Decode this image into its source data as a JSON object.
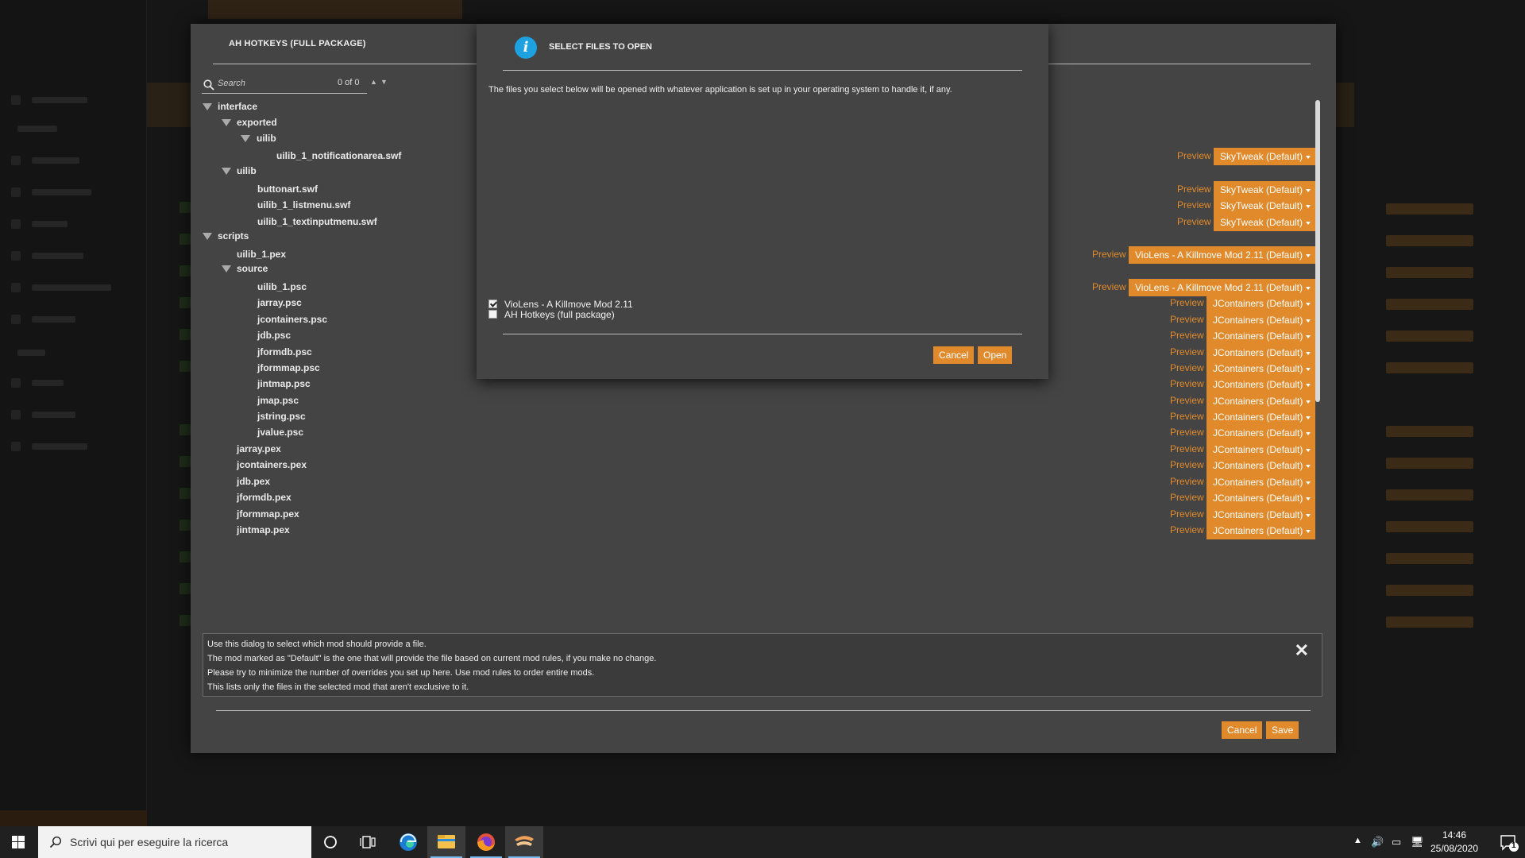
{
  "background_app": {
    "footer_text": "",
    "window_controls": [
      "minimize",
      "maximize",
      "close"
    ]
  },
  "overrides_dialog": {
    "title": "AH HOTKEYS (FULL PACKAGE)",
    "search": {
      "placeholder": "Search",
      "value": "",
      "count": "0 of 0",
      "up": "▲",
      "down": "▼"
    },
    "tree": [
      {
        "name": "interface",
        "depth": 0,
        "expandable": true
      },
      {
        "name": "exported",
        "depth": 1,
        "expandable": true
      },
      {
        "name": "uilib",
        "depth": 2,
        "expandable": true
      },
      {
        "name": "uilib_1_notificationarea.swf",
        "depth": 3,
        "expandable": false,
        "preview": "Preview",
        "provider": "SkyTweak (Default)"
      },
      {
        "name": "uilib",
        "depth": 1,
        "expandable": true
      },
      {
        "name": "buttonart.swf",
        "depth": 2,
        "expandable": false,
        "preview": "Preview",
        "provider": "SkyTweak (Default)"
      },
      {
        "name": "uilib_1_listmenu.swf",
        "depth": 2,
        "expandable": false,
        "preview": "Preview",
        "provider": "SkyTweak (Default)"
      },
      {
        "name": "uilib_1_textinputmenu.swf",
        "depth": 2,
        "expandable": false,
        "preview": "Preview",
        "provider": "SkyTweak (Default)"
      },
      {
        "name": "scripts",
        "depth": 0,
        "expandable": true
      },
      {
        "name": "uilib_1.pex",
        "depth": 1,
        "expandable": false,
        "preview": "Preview",
        "provider": "VioLens - A Killmove Mod 2.11 (Default)"
      },
      {
        "name": "source",
        "depth": 1,
        "expandable": true
      },
      {
        "name": "uilib_1.psc",
        "depth": 2,
        "expandable": false,
        "preview": "Preview",
        "provider": "VioLens - A Killmove Mod 2.11 (Default)"
      },
      {
        "name": "jarray.psc",
        "depth": 2,
        "expandable": false,
        "preview": "Preview",
        "provider": "JContainers (Default)"
      },
      {
        "name": "jcontainers.psc",
        "depth": 2,
        "expandable": false,
        "preview": "Preview",
        "provider": "JContainers (Default)"
      },
      {
        "name": "jdb.psc",
        "depth": 2,
        "expandable": false,
        "preview": "Preview",
        "provider": "JContainers (Default)"
      },
      {
        "name": "jformdb.psc",
        "depth": 2,
        "expandable": false,
        "preview": "Preview",
        "provider": "JContainers (Default)"
      },
      {
        "name": "jformmap.psc",
        "depth": 2,
        "expandable": false,
        "preview": "Preview",
        "provider": "JContainers (Default)"
      },
      {
        "name": "jintmap.psc",
        "depth": 2,
        "expandable": false,
        "preview": "Preview",
        "provider": "JContainers (Default)"
      },
      {
        "name": "jmap.psc",
        "depth": 2,
        "expandable": false,
        "preview": "Preview",
        "provider": "JContainers (Default)"
      },
      {
        "name": "jstring.psc",
        "depth": 2,
        "expandable": false,
        "preview": "Preview",
        "provider": "JContainers (Default)"
      },
      {
        "name": "jvalue.psc",
        "depth": 2,
        "expandable": false,
        "preview": "Preview",
        "provider": "JContainers (Default)"
      },
      {
        "name": "jarray.pex",
        "depth": 1,
        "expandable": false,
        "preview": "Preview",
        "provider": "JContainers (Default)"
      },
      {
        "name": "jcontainers.pex",
        "depth": 1,
        "expandable": false,
        "preview": "Preview",
        "provider": "JContainers (Default)"
      },
      {
        "name": "jdb.pex",
        "depth": 1,
        "expandable": false,
        "preview": "Preview",
        "provider": "JContainers (Default)"
      },
      {
        "name": "jformdb.pex",
        "depth": 1,
        "expandable": false,
        "preview": "Preview",
        "provider": "JContainers (Default)"
      },
      {
        "name": "jformmap.pex",
        "depth": 1,
        "expandable": false,
        "preview": "Preview",
        "provider": "JContainers (Default)"
      },
      {
        "name": "jintmap.pex",
        "depth": 1,
        "expandable": false,
        "preview": "Preview",
        "provider": "JContainers (Default)"
      }
    ],
    "info_lines": [
      "Use this dialog to select which mod should provide a file.",
      "The mod marked as \"Default\" is the one that will provide the file based on current mod rules, if you make no change.",
      "Please try to minimize the number of overrides you set up here. Use mod rules to order entire mods.",
      "This lists only the files in the selected mod that aren't exclusive to it."
    ],
    "info_close": "✕",
    "cancel_label": "Cancel",
    "save_label": "Save"
  },
  "open_modal": {
    "icon": "info-icon",
    "icon_glyph": "i",
    "title": "SELECT FILES TO OPEN",
    "description": "The files you select below will be opened with whatever application is set up in your operating system to handle it, if any.",
    "files": [
      {
        "label": "VioLens - A Killmove Mod 2.11",
        "checked": true
      },
      {
        "label": "AH Hotkeys (full package)",
        "checked": false
      }
    ],
    "cancel_label": "Cancel",
    "open_label": "Open"
  },
  "taskbar": {
    "search_placeholder": "Scrivi qui per eseguire la ricerca",
    "apps": [
      "cortana-icon",
      "task-view-icon",
      "edge-icon",
      "file-explorer-icon",
      "firefox-icon",
      "mod-manager-icon"
    ],
    "time": "14:46",
    "date": "25/08/2020",
    "notification_count": "1"
  },
  "colors": {
    "accent": "#e08a2c",
    "dialog_bg": "#444444",
    "info_icon": "#1ea1e0",
    "taskbar": "#202020"
  }
}
